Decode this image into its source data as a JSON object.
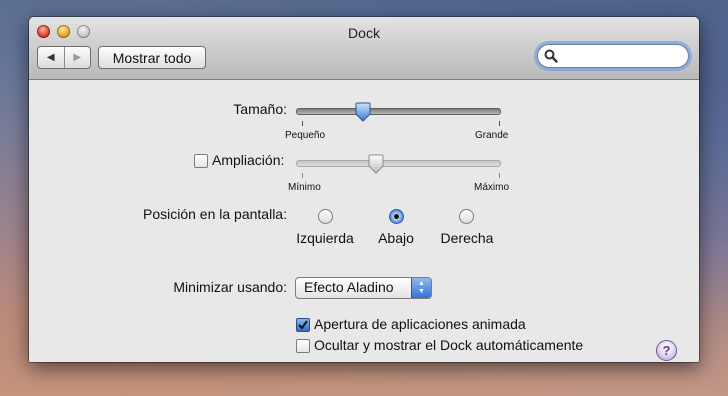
{
  "window": {
    "title": "Dock"
  },
  "toolbar": {
    "show_all_label": "Mostrar todo",
    "back_glyph": "◀",
    "forward_glyph": "▶",
    "search_placeholder": "",
    "search_icon": "magnifier-icon"
  },
  "size": {
    "label": "Tamaño:",
    "min_label": "Pequeño",
    "max_label": "Grande",
    "value_fraction": 0.33
  },
  "magnification": {
    "label": "Ampliación:",
    "checked": false,
    "min_label": "Mínimo",
    "max_label": "Máximo",
    "value_fraction": 0.39
  },
  "position": {
    "label": "Posición en la pantalla:",
    "options": [
      "Izquierda",
      "Abajo",
      "Derecha"
    ],
    "selected": "Abajo"
  },
  "minimize": {
    "label": "Minimizar usando:",
    "selected": "Efecto Aladino"
  },
  "options": {
    "animate_label": "Apertura de aplicaciones animada",
    "animate_checked": true,
    "autohide_label": "Ocultar y mostrar el Dock automáticamente",
    "autohide_checked": false
  },
  "help": {
    "glyph": "?"
  }
}
